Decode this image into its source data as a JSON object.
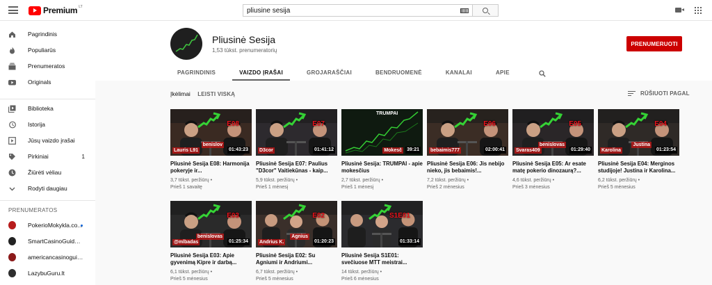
{
  "topbar": {
    "logo_text": "Premium",
    "logo_sup": "LT",
    "search_value": "pliusine sesija"
  },
  "sidebar": {
    "main": [
      {
        "label": "Pagrindinis",
        "icon": "home-icon"
      },
      {
        "label": "Populiarūs",
        "icon": "fire-icon"
      },
      {
        "label": "Prenumeratos",
        "icon": "subscriptions-icon"
      },
      {
        "label": "Originals",
        "icon": "youtube-originals-icon"
      }
    ],
    "library": [
      {
        "label": "Biblioteka",
        "icon": "library-icon",
        "count": ""
      },
      {
        "label": "Istorija",
        "icon": "history-icon",
        "count": ""
      },
      {
        "label": "Jūsų vaizdo įrašai",
        "icon": "your-videos-icon",
        "count": ""
      },
      {
        "label": "Pirkiniai",
        "icon": "purchases-icon",
        "count": "1"
      },
      {
        "label": "Žiūrėti vėliau",
        "icon": "watch-later-icon",
        "count": ""
      },
      {
        "label": "Rodyti daugiau",
        "icon": "chevron-down-icon",
        "count": ""
      }
    ],
    "subs_heading": "PRENUMERATOS",
    "subscriptions": [
      {
        "label": "PokerioMokykla.co...",
        "avatar_color": "#b71c1c",
        "new": true
      },
      {
        "label": "SmartCasinoGuide.c...",
        "avatar_color": "#222222",
        "new": false
      },
      {
        "label": "americancasinoguide",
        "avatar_color": "#8b1a1a",
        "new": false
      },
      {
        "label": "LazybuGuru.lt",
        "avatar_color": "#2e2e2e",
        "new": false
      }
    ]
  },
  "channel": {
    "name": "Pliusinė Sesija",
    "subscribers": "1,53 tūkst. prenumeratorių",
    "subscribe_label": "PRENUMERUOTI",
    "tabs": [
      "PAGRINDINIS",
      "VAIZDO ĮRAŠAI",
      "GROJARAŠČIAI",
      "BENDRUOMENĖ",
      "KANALAI",
      "APIE"
    ],
    "active_tab": "VAIZDO ĮRAŠAI"
  },
  "content": {
    "filter_label": "Įkėlimai",
    "filter_all": "LEISTI VISKĄ",
    "sort_label": "RŪŠIUOTI PAGAL"
  },
  "videos": [
    {
      "title": "Pliusinė Sesija E08: Harmonija pokeryje ir...",
      "duration": "01:43:23",
      "views": "3,7 tūkst. peržiūrų",
      "age": "Prieš 1 savaitę",
      "tag": "E08",
      "name_left": "Lauris L91",
      "name_right": "benislov",
      "kind": "duo"
    },
    {
      "title": "Pliusinė Sesija E07: Paulius \"D3cor\" Vaitiekūnas - kaip...",
      "duration": "01:41:12",
      "views": "5,9 tūkst. peržiūrų",
      "age": "Prieš 1 mėnesį",
      "tag": "E07",
      "name_left": "D3cor",
      "name_right": "",
      "kind": "duo"
    },
    {
      "title": "Pliusinė Sesija: TRUMPAI - apie mokesčius",
      "duration": "39:21",
      "views": "2,7 tūkst. peržiūrų",
      "age": "Prieš 1 mėnesį",
      "tag": "TRUMPAI",
      "name_left": "",
      "name_right": "Mokesč",
      "kind": "chart"
    },
    {
      "title": "Pliusinė Sesija E06: Jis nebijo nieko, jis bebaimis!...",
      "duration": "02:00:41",
      "views": "7,2 tūkst. peržiūrų",
      "age": "Prieš 2 mėnesius",
      "tag": "E06",
      "name_left": "bebaimis777",
      "name_right": "",
      "kind": "duo"
    },
    {
      "title": "Pliusinė Sesija E05: Ar esate matę pokerio dinozaurą?...",
      "duration": "01:29:40",
      "views": "4,6 tūkst. peržiūrų",
      "age": "Prieš 3 mėnesius",
      "tag": "E05",
      "name_left": "Svaras409",
      "name_right": "benislovas",
      "kind": "duo"
    },
    {
      "title": "Pliusinė Sesija E04: Merginos studijoje! Justina ir Karolina...",
      "duration": "01:23:54",
      "views": "6,2 tūkst. peržiūrų",
      "age": "Prieš 5 mėnesius",
      "tag": "E04",
      "name_left": "Karolina",
      "name_right": "Justina",
      "kind": "duo"
    },
    {
      "title": "Pliusinė Sesija E03: Apie gyvenimą Kipre ir darbą...",
      "duration": "01:25:34",
      "views": "6,1 tūkst. peržiūrų",
      "age": "Prieš 5 mėnesius",
      "tag": "E03",
      "name_left": "@mlbadas",
      "name_right": "benislovas",
      "kind": "duo"
    },
    {
      "title": "Pliusinė Sesija E02: Su Agniumi ir Andriumi...",
      "duration": "01:20:23",
      "views": "6,7 tūkst. peržiūrų",
      "age": "Prieš 5 mėnesius",
      "tag": "E02",
      "name_left": "Andrius K.",
      "name_right": "Agnius",
      "kind": "trio"
    },
    {
      "title": "Pliusinė Sesija S1E01: svečiuose MTT meistrai...",
      "duration": "01:33:14",
      "views": "14 tūkst. peržiūrų",
      "age": "Prieš 6 mėnesius",
      "tag": "S1E01",
      "name_left": "",
      "name_right": "",
      "kind": "trio"
    }
  ]
}
